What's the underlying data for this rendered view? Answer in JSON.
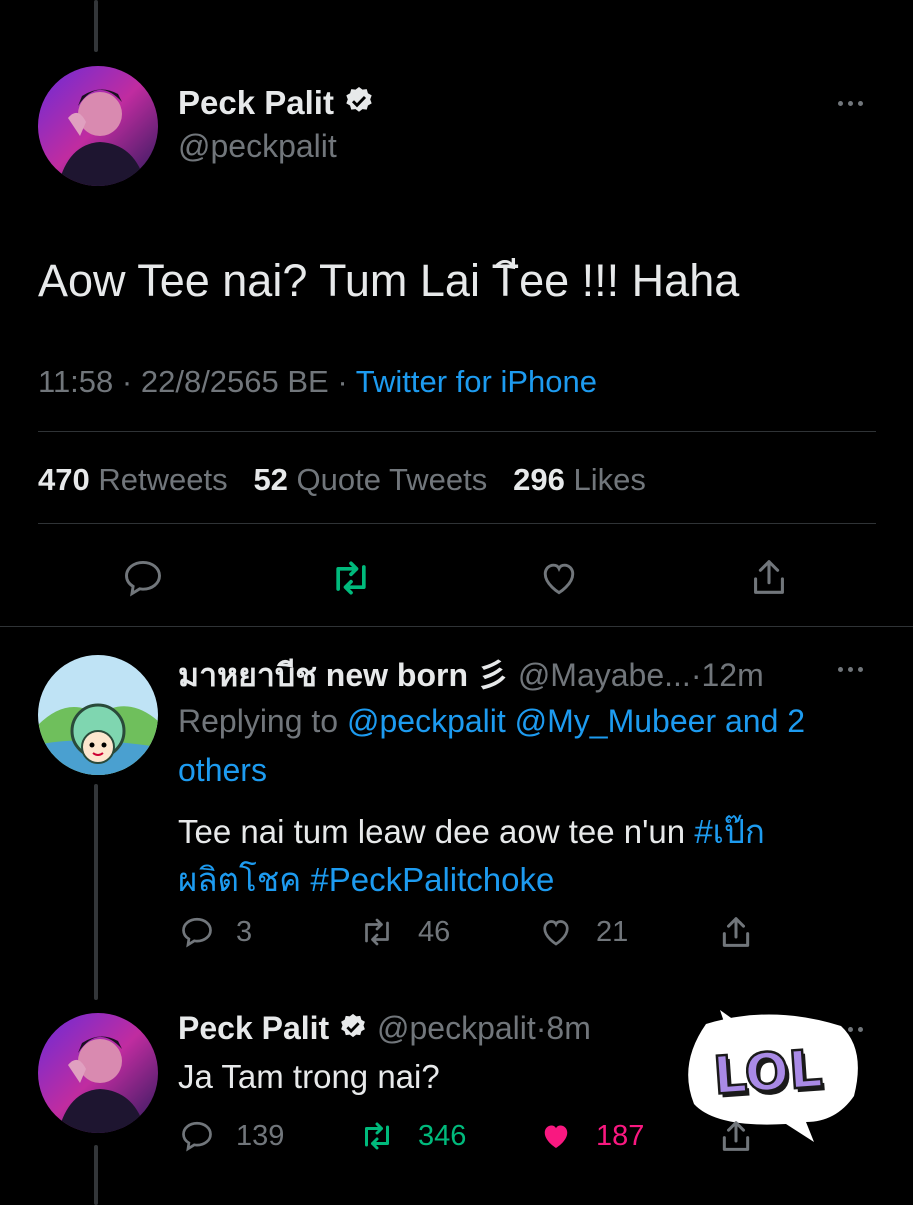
{
  "main_tweet": {
    "name": "Peck Palit",
    "handle": "@peckpalit",
    "text": "Aow Tee nai? Tum Lai Tีee !!! Haha",
    "time": "11:58",
    "sep1": "·",
    "date": "22/8/2565 BE",
    "sep2": "·",
    "source": "Twitter for iPhone",
    "stats": {
      "retweets_count": "470",
      "retweets_label": "Retweets",
      "quotes_count": "52",
      "quotes_label": "Quote Tweets",
      "likes_count": "296",
      "likes_label": "Likes"
    }
  },
  "reply1": {
    "name": "มาหยาบีช new born",
    "name_emoji": "彡",
    "handle": "@Mayabe...",
    "sep": "·",
    "time": "12m",
    "replying_prefix": "Replying to",
    "replying_to": "@peckpalit @My_Mubeer and 2",
    "replying_to_2": "others",
    "text": "Tee nai tum leaw dee aow tee n'un",
    "hashtag1": "#เป๊ก",
    "hashtag1b": "ผลิตโชค",
    "hashtag2": "#PeckPalitchoke",
    "reply_count": "3",
    "retweet_count": "46",
    "like_count": "21"
  },
  "reply2": {
    "name": "Peck Palit",
    "handle": "@peckpalit",
    "sep": "·",
    "time": "8m",
    "text": "Ja Tam trong nai?",
    "reply_count": "139",
    "retweet_count": "346",
    "like_count": "187",
    "sticker_text": "LOL"
  },
  "colors": {
    "accent_blue": "#1d9bf0",
    "retweet_green": "#00ba7c",
    "like_pink": "#f91880",
    "muted": "#71767b"
  }
}
